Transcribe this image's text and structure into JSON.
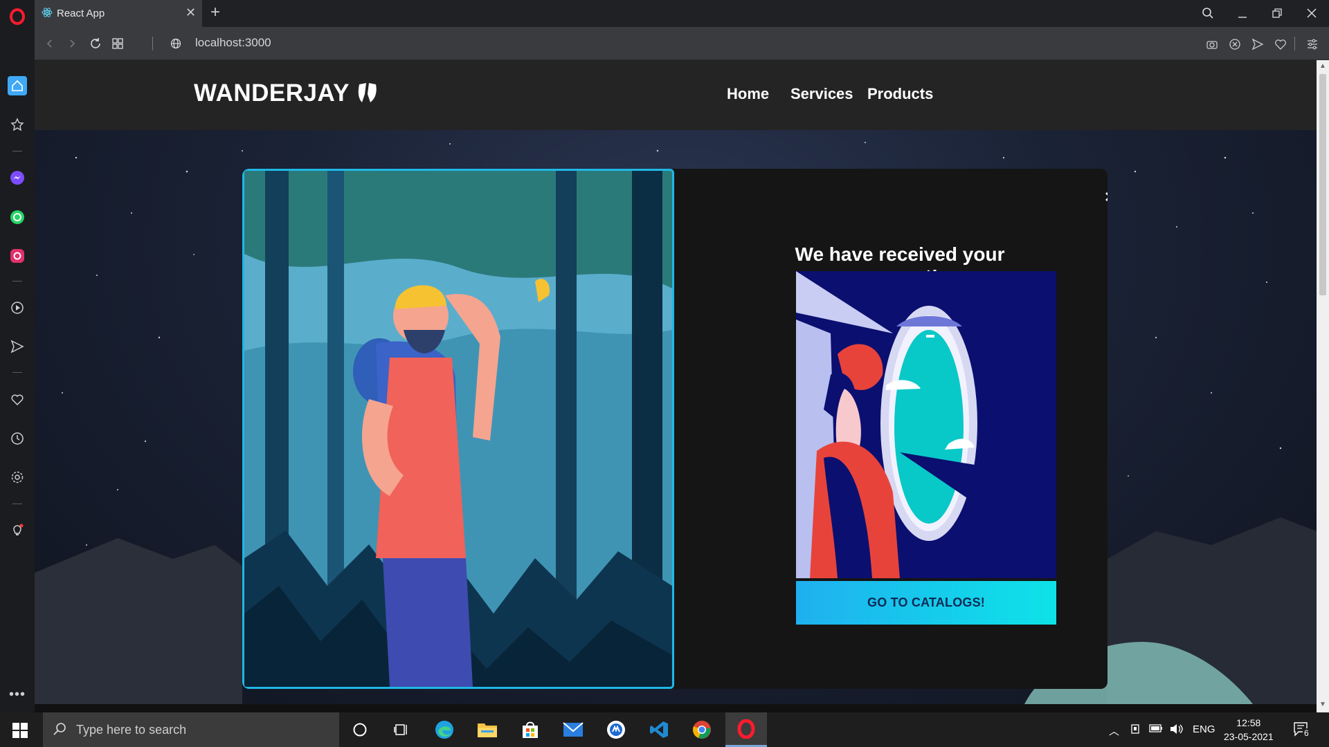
{
  "browser": {
    "tab_title": "React App",
    "url": "localhost:3000"
  },
  "site": {
    "brand": "WANDERJAY",
    "nav": [
      {
        "label": "Home"
      },
      {
        "label": "Services"
      },
      {
        "label": "Products"
      }
    ]
  },
  "modal": {
    "title": "We have received your request!",
    "cta_label": "GO TO CATALOGS!",
    "close_symbol": "×"
  },
  "taskbar": {
    "search_placeholder": "Type here to search",
    "language": "ENG",
    "time": "12:58",
    "date": "23-05-2021",
    "notification_count": "6"
  },
  "icons": {
    "sidebar": [
      "home-icon",
      "star-icon",
      "messenger-icon",
      "whatsapp-icon",
      "instagram-icon",
      "player-icon",
      "send-icon",
      "heart-icon",
      "history-icon",
      "settings-icon",
      "tips-icon",
      "more-icon"
    ],
    "taskbar_apps": [
      "cortana-icon",
      "task-view-icon",
      "edge-icon",
      "file-explorer-icon",
      "store-icon",
      "mail-icon",
      "app-icon",
      "vscode-icon",
      "chrome-icon",
      "opera-icon"
    ]
  },
  "colors": {
    "accent": "#1fb8e6",
    "cta_start": "#1fb0ef",
    "cta_end": "#0ee3e8",
    "modal_bg": "#151515",
    "nav_bg": "#242424"
  }
}
